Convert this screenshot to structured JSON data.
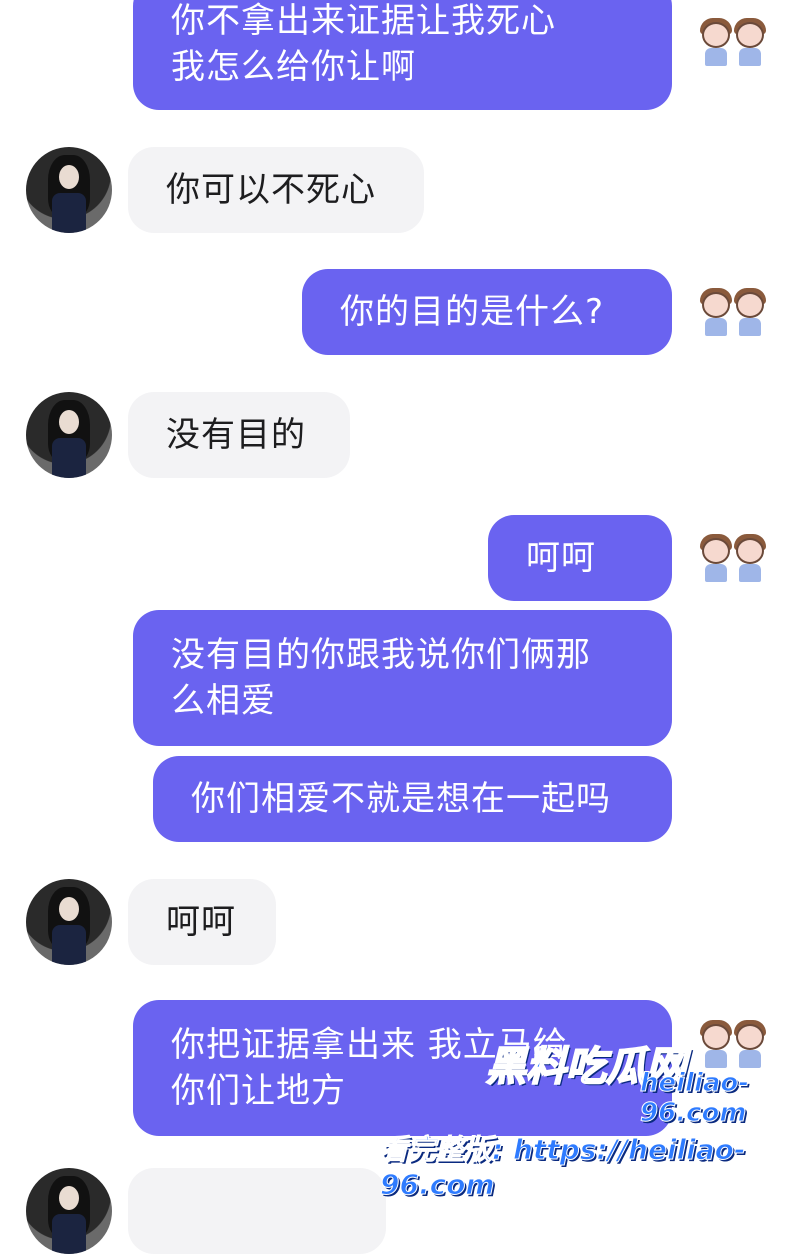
{
  "messages": [
    {
      "side": "out",
      "text": "你不拿出来证据让我死心\n我怎么给你让啊"
    },
    {
      "side": "in",
      "text": "你可以不死心"
    },
    {
      "side": "out",
      "text": "你的目的是什么?"
    },
    {
      "side": "in",
      "text": "没有目的"
    },
    {
      "side": "out",
      "text": "呵呵"
    },
    {
      "side": "out",
      "text": "没有目的你跟我说你们俩那\n么相爱"
    },
    {
      "side": "out",
      "text": "你们相爱不就是想在一起吗"
    },
    {
      "side": "in",
      "text": "呵呵"
    },
    {
      "side": "out",
      "text": "你把证据拿出来  我立马给\n你们让地方"
    }
  ],
  "watermark": {
    "logo": "黑料吃瓜网",
    "url": "heiliao-96.com",
    "bottom": "看完整版: https://heiliao-96.com"
  },
  "colors": {
    "outgoing_bubble": "#6a63f0",
    "incoming_bubble": "#f3f3f5",
    "watermark": "#2e7bff"
  },
  "icons": {
    "friend_avatar": "woman-photo-avatar",
    "self_avatar": "cartoon-couple-avatar"
  }
}
